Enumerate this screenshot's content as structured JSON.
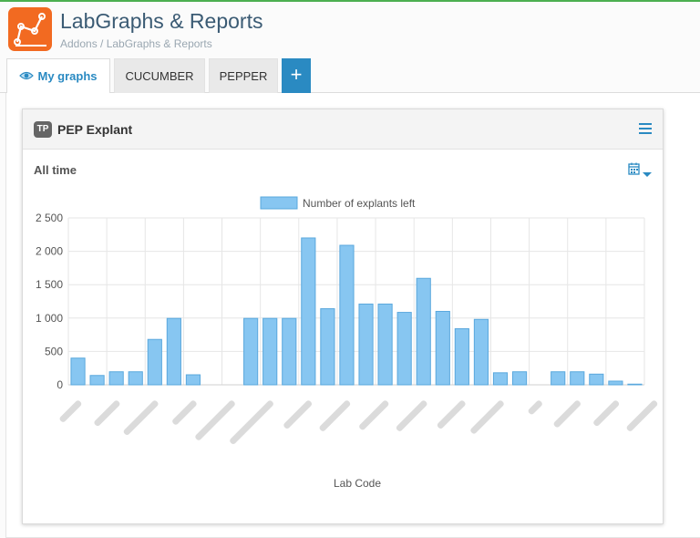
{
  "app": {
    "title": "LabGraphs & Reports",
    "breadcrumb": "Addons / LabGraphs & Reports",
    "icon": "line-graph-icon",
    "accent": "#f26a21"
  },
  "tabs": [
    {
      "label": "My graphs",
      "icon": "eye-icon",
      "active": true
    },
    {
      "label": "CUCUMBER",
      "active": false
    },
    {
      "label": "PEPPER",
      "active": false
    }
  ],
  "add_tab": {
    "label": "+"
  },
  "card": {
    "badge": "TP",
    "title": "PEP Explant",
    "range_label": "All time"
  },
  "colors": {
    "primary": "#2a8ac2",
    "bar_fill": "#87c6f1",
    "bar_stroke": "#5aa8dd"
  },
  "chart_data": {
    "type": "bar",
    "title": "",
    "xlabel": "Lab Code",
    "ylabel": "",
    "ylim": [
      0,
      2500
    ],
    "yticks": [
      "0",
      "500",
      "1 000",
      "1 500",
      "2 000",
      "2 500"
    ],
    "grid": true,
    "legend_position": "top",
    "series": [
      {
        "name": "Number of explants left",
        "values": [
          400,
          140,
          195,
          195,
          680,
          995,
          150,
          0,
          0,
          995,
          995,
          995,
          2200,
          1140,
          2090,
          1210,
          1210,
          1085,
          1595,
          1100,
          840,
          980,
          180,
          195,
          0,
          195,
          195,
          160,
          55,
          10
        ]
      }
    ],
    "x_labels_note": "blurred"
  }
}
